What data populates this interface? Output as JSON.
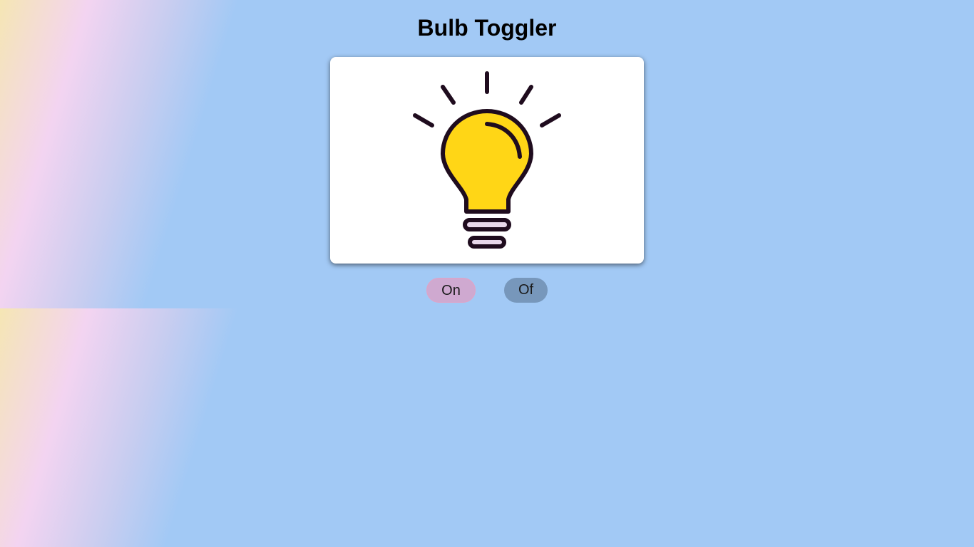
{
  "header": {
    "title": "Bulb Toggler"
  },
  "bulb": {
    "state": "on",
    "icon": "lightbulb-icon",
    "fill_color": "#ffd616",
    "outline_color": "#1f0c1e"
  },
  "controls": {
    "on_label": "On",
    "off_label": "Of"
  }
}
